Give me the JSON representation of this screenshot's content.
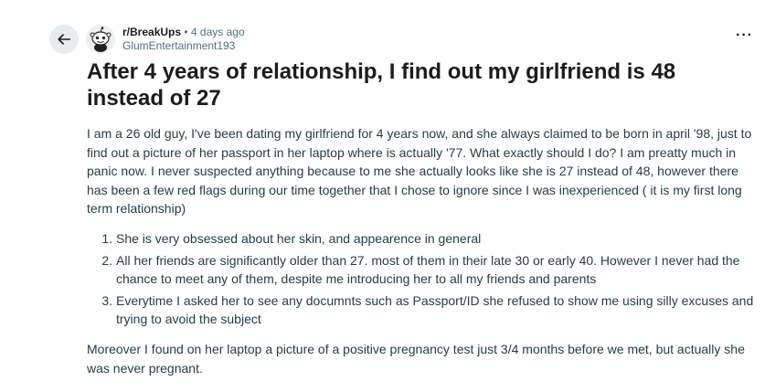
{
  "post": {
    "subreddit": "r/BreakUps",
    "separator": "•",
    "time": "4 days ago",
    "author": "GlumEntertainment193",
    "title": "After 4 years of relationship, I find out my girlfriend is 48 instead of 27",
    "paragraph1": "I am a 26 old guy, I've been dating my girlfriend for 4 years now, and she always claimed to be born in april '98, just to find out a picture of her passport in her laptop where is actually '77. What exactly should I do? I am preatty much in panic now. I never suspected anything because to me she actually looks like she is 27 instead of 48, however there has been a few red flags during our time together that I chose to ignore since I was inexperienced ( it is my first long term relationship)",
    "list": [
      "She is very obsessed about her skin, and appearence in general",
      "All her friends are significantly older than 27. most of them in their late 30 or early 40. However I never had the chance to meet any of them, despite me introducing her to all my friends and parents",
      "Everytime I asked her to see any documnts such as Passport/ID she refused to show me using silly excuses and trying to avoid the subject"
    ],
    "paragraph2": "Moreover I found on her laptop a picture of a positive pregnancy test just 3/4 months before we met, but actually she was never pregnant."
  },
  "icons": {
    "back": "arrow-left-icon",
    "avatar": "snoo-avatar",
    "overflow": "more-options-icon"
  },
  "colors": {
    "text": "#1c1c1c",
    "meta": "#576f76",
    "body_text": "#2a3c42",
    "back_bg": "#e9ebed"
  }
}
